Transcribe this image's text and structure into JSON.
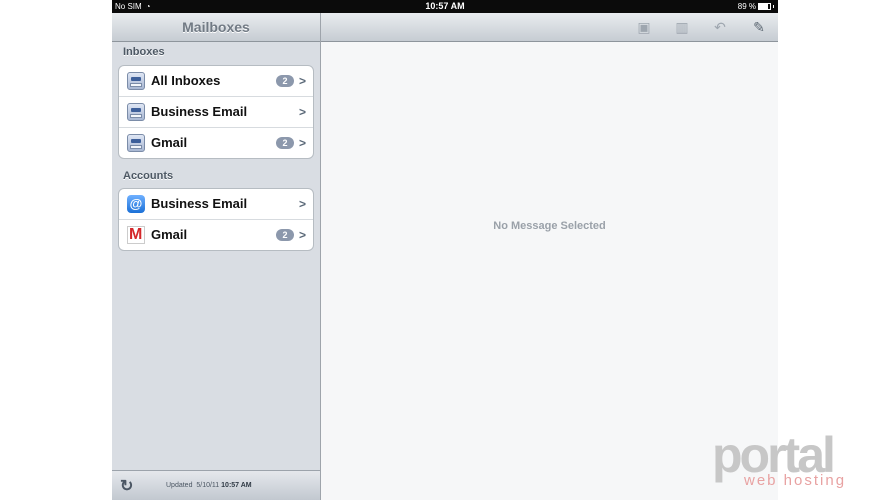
{
  "status_bar": {
    "carrier": "No SIM",
    "time": "10:57 AM",
    "battery": "89 %"
  },
  "sidebar": {
    "title": "Mailboxes",
    "inboxes_label": "Inboxes",
    "inboxes": [
      {
        "label": "All Inboxes",
        "badge": "2",
        "icon": "inbox-icon"
      },
      {
        "label": "Business Email",
        "badge": "",
        "icon": "inbox-icon"
      },
      {
        "label": "Gmail",
        "badge": "2",
        "icon": "inbox-icon"
      }
    ],
    "accounts_label": "Accounts",
    "accounts": [
      {
        "label": "Business Email",
        "badge": "",
        "icon": "at-icon"
      },
      {
        "label": "Gmail",
        "badge": "2",
        "icon": "gmail-icon"
      }
    ],
    "footer": {
      "updated_label": "Updated",
      "date": "5/10/11",
      "time": "10:57 AM"
    }
  },
  "main": {
    "empty_message": "No Message Selected"
  },
  "watermark": {
    "logo_text": "portal",
    "logo_sub": "web hosting"
  }
}
